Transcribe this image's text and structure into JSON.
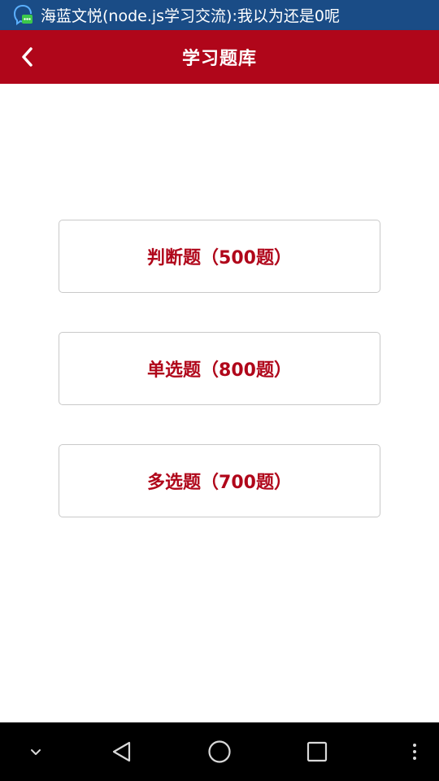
{
  "status_bar": {
    "notification_text": "海蓝文悦(node.js学习交流):我以为还是0呢",
    "notification_icon": "chat-bubble-icon",
    "background_color": "#1a4c86"
  },
  "app_bar": {
    "title": "学习题库",
    "back_icon": "chevron-left-icon",
    "background_color": "#b0061a"
  },
  "question_banks": [
    {
      "label": "判断题（500题）"
    },
    {
      "label": "单选题（800题）"
    },
    {
      "label": "多选题（700题）"
    }
  ],
  "nav_bar": {
    "icons": [
      "chevron-down-icon",
      "back-triangle-icon",
      "home-circle-icon",
      "recents-square-icon",
      "more-vertical-icon"
    ]
  },
  "colors": {
    "accent": "#b0061a",
    "button_border": "#c9c9c9"
  }
}
